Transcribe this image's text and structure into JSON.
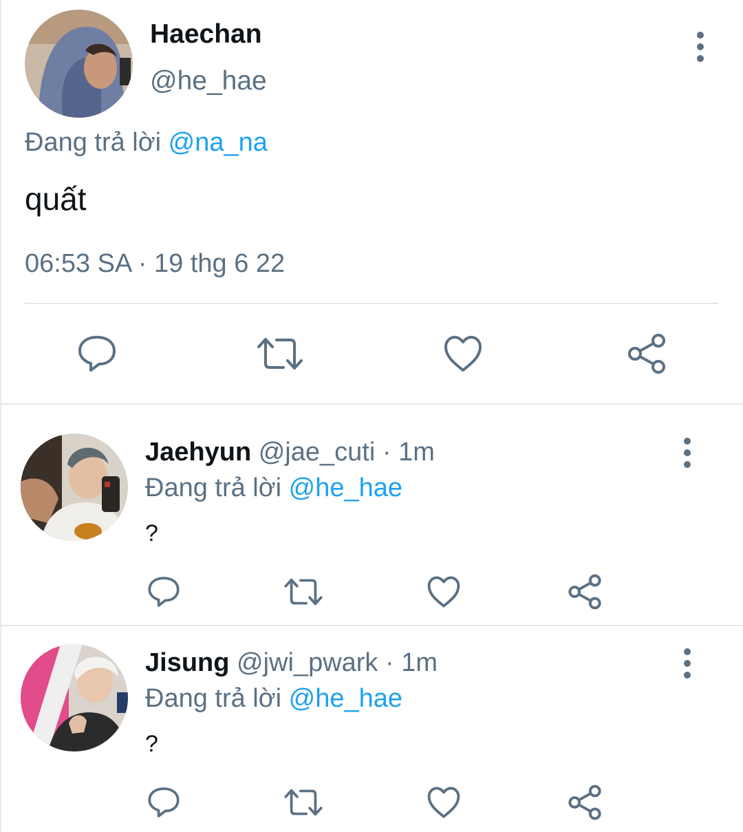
{
  "main_tweet": {
    "name": "Haechan",
    "handle": "@he_hae",
    "reply_prefix": "Đang trả lời",
    "reply_to": "@na_na",
    "text": "quất",
    "timestamp": "06:53 SA · 19 thg 6 22"
  },
  "replies": [
    {
      "name": "Jaehyun",
      "handle": "@jae_cuti",
      "time": "· 1m",
      "reply_prefix": "Đang trả lời",
      "reply_to": "@he_hae",
      "text": "?"
    },
    {
      "name": "Jisung",
      "handle": "@jwi_pwark",
      "time": "· 1m",
      "reply_prefix": "Đang trả lời",
      "reply_to": "@he_hae",
      "text": "?"
    }
  ],
  "icons": {
    "reply": "reply-icon",
    "retweet": "retweet-icon",
    "like": "like-icon",
    "share": "share-icon",
    "more": "more-vertical-icon"
  },
  "colors": {
    "icon": "#5b7083",
    "mention": "#1da1f2",
    "secondary_text": "#5b7083"
  }
}
